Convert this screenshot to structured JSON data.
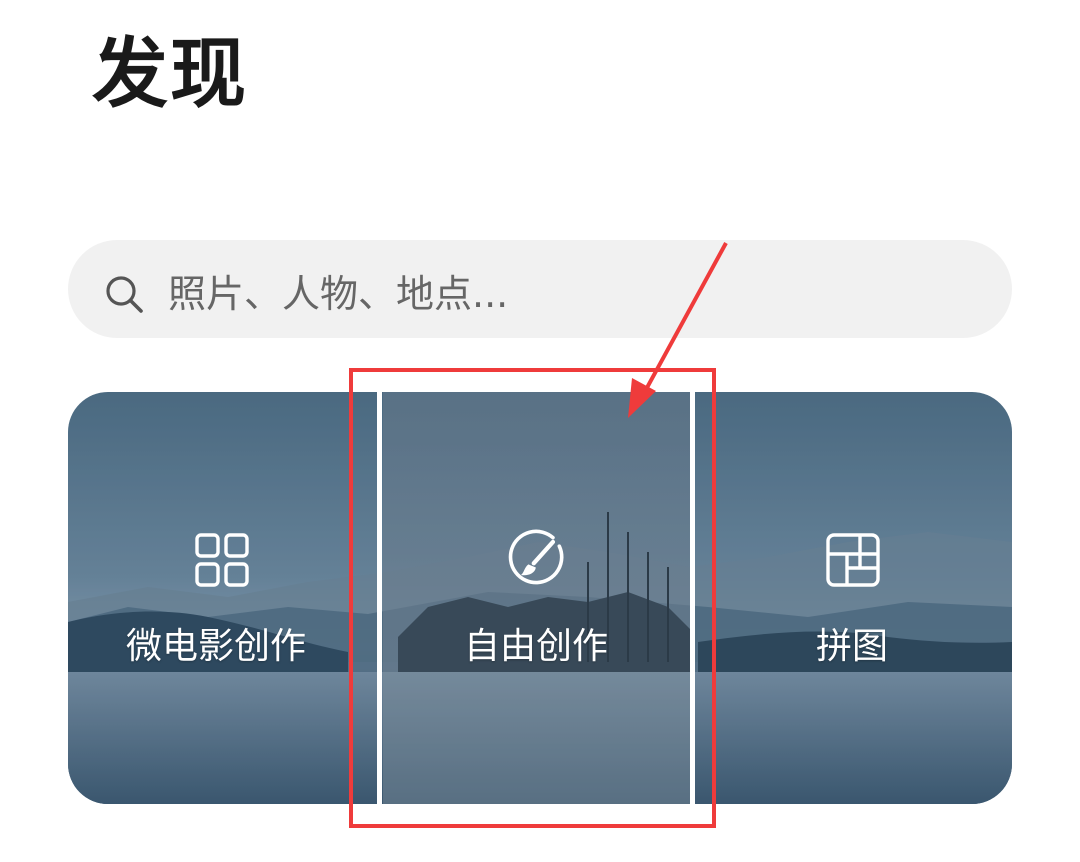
{
  "page": {
    "title": "发现"
  },
  "search": {
    "placeholder": "照片、人物、地点..."
  },
  "tiles": [
    {
      "label": "微电影创作",
      "icon": "grid-four-icon"
    },
    {
      "label": "自由创作",
      "icon": "brush-circle-icon"
    },
    {
      "label": "拼图",
      "icon": "collage-icon"
    }
  ],
  "annotation": {
    "color": "#ef3b3b"
  }
}
